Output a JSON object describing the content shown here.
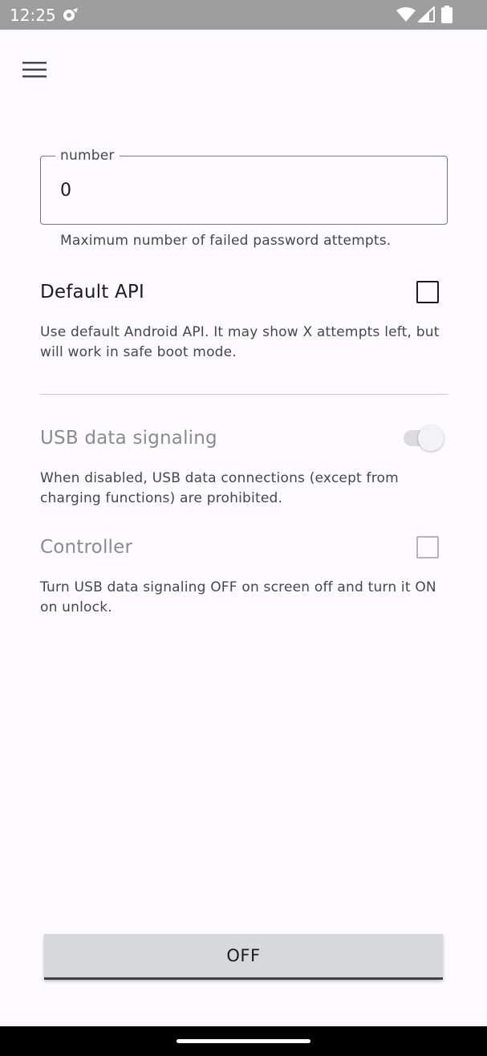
{
  "status_bar": {
    "time": "12:25",
    "icons": [
      "sync-icon",
      "wifi-icon",
      "cell-signal-icon",
      "battery-icon"
    ]
  },
  "app_bar": {
    "menu_icon": "menu-icon"
  },
  "number_field": {
    "label": "number",
    "value": "0",
    "helper": "Maximum number of failed password attempts."
  },
  "default_api": {
    "title": "Default API",
    "checked": false,
    "description": "Use default Android API. It may show X attempts left, but will work in safe boot mode."
  },
  "usb_signaling": {
    "title": "USB data signaling",
    "enabled": false,
    "on": true,
    "description": "When disabled, USB data connections (except from charging functions) are prohibited."
  },
  "controller": {
    "title": "Controller",
    "enabled": false,
    "checked": false,
    "description": "Turn USB data signaling OFF on screen off and turn it ON on unlock."
  },
  "action_button": {
    "label": "OFF"
  },
  "colors": {
    "background": "#fdfbff",
    "status_bar": "#9e9e9e",
    "outline": "#74777f",
    "disabled_text": "#8a8b90",
    "button": "#d7d8d9"
  }
}
